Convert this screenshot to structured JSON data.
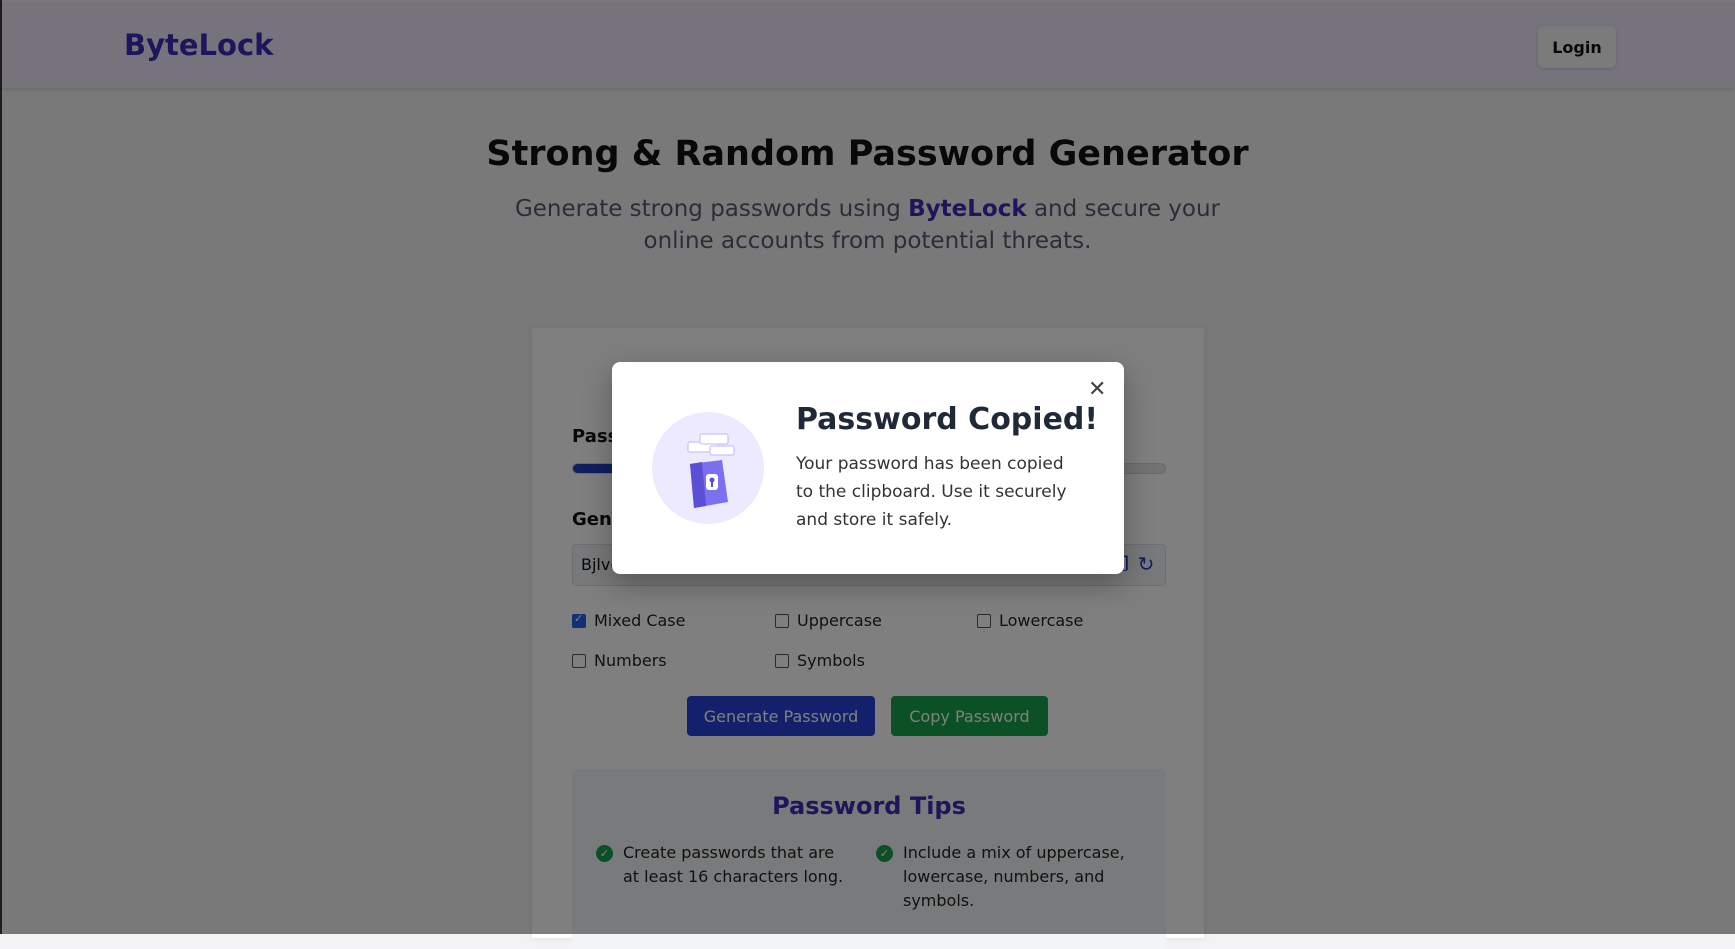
{
  "navbar": {
    "brand": "ByteLock",
    "login_label": "Login"
  },
  "hero": {
    "title": "Strong & Random Password Generator",
    "subtitle_pre": "Generate strong passwords using ",
    "subtitle_brand": "ByteLock",
    "subtitle_post": " and secure your online accounts from potential threats."
  },
  "generator": {
    "strength_label": "Passw",
    "strength_level": 0.09,
    "generated_label": "Gene",
    "password_value": "Bjlvc",
    "options": [
      {
        "label": "Mixed Case",
        "checked": true
      },
      {
        "label": "Uppercase",
        "checked": false
      },
      {
        "label": "Lowercase",
        "checked": false
      },
      {
        "label": "Numbers",
        "checked": false
      },
      {
        "label": "Symbols",
        "checked": false
      }
    ],
    "generate_label": "Generate Password",
    "copy_label": "Copy Password"
  },
  "tips": {
    "title": "Password Tips",
    "items": [
      "Create passwords that are at least 16 characters long.",
      "Include a mix of uppercase, lowercase, numbers, and symbols."
    ]
  },
  "modal": {
    "title": "Password Copied!",
    "text": "Your password has been copied to the clipboard. Use it securely and store it safely.",
    "close_icon": "close-icon",
    "illustration_icon": "vault-lock-icon"
  },
  "colors": {
    "accent": "#3a2db5",
    "primary_button": "#2743d8",
    "success": "#16a34a"
  }
}
